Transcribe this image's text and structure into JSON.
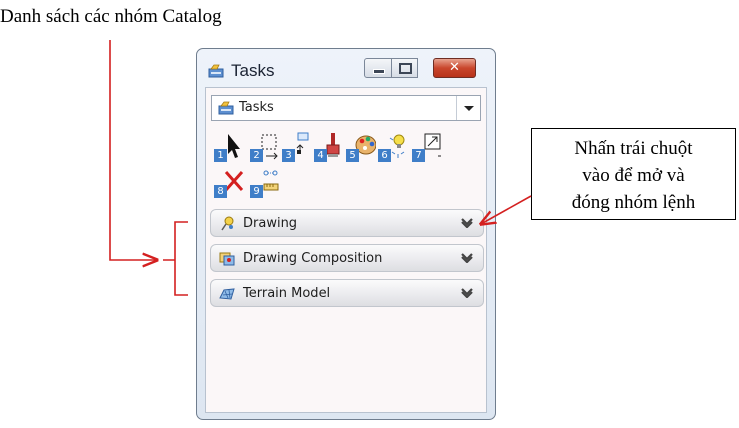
{
  "annotations": {
    "top_label": "Danh sách các nhóm Catalog",
    "callout_lines": [
      "Nhấn trái chuột",
      "vào để mở và",
      "đóng nhóm lệnh"
    ]
  },
  "window": {
    "title": "Tasks",
    "title_icon": "tasks-icon",
    "controls": [
      "minimize",
      "maximize",
      "close"
    ],
    "close_symbol": "✕"
  },
  "dropdown": {
    "value": "Tasks",
    "icon": "tasks-icon"
  },
  "tools": [
    {
      "number": "1",
      "icon": "select-arrow-icon"
    },
    {
      "number": "2",
      "icon": "fence-icon"
    },
    {
      "number": "3",
      "icon": "move-to-front-icon"
    },
    {
      "number": "4",
      "icon": "paint-brush-icon"
    },
    {
      "number": "5",
      "icon": "palette-icon"
    },
    {
      "number": "6",
      "icon": "lightbulb-icon"
    },
    {
      "number": "7",
      "icon": "scale-icon"
    },
    {
      "number": "8",
      "icon": "delete-x-icon"
    },
    {
      "number": "9",
      "icon": "measure-icon"
    }
  ],
  "groups": [
    {
      "label": "Drawing",
      "icon": "drawing-pin-icon"
    },
    {
      "label": "Drawing Composition",
      "icon": "drawing-composition-icon"
    },
    {
      "label": "Terrain Model",
      "icon": "terrain-model-icon"
    }
  ],
  "colors": {
    "annotation_red": "#d42020",
    "tool_number_bg": "#3f7ec8",
    "close_button": "#c9462c"
  }
}
